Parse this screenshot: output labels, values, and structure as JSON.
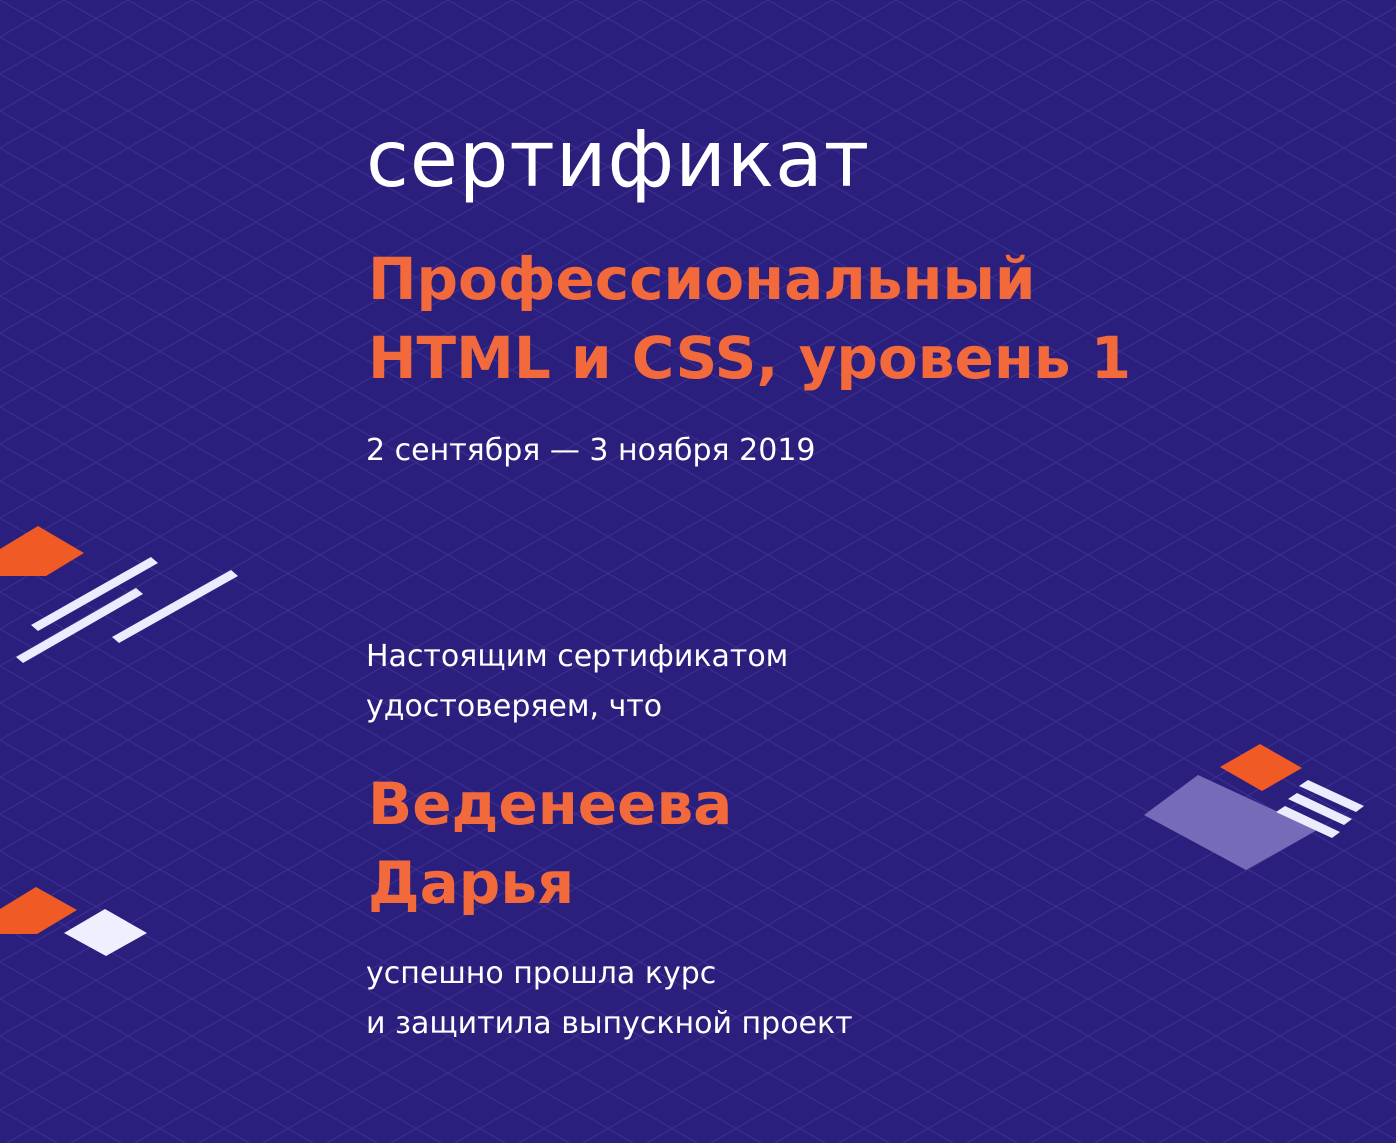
{
  "certificate": {
    "heading": "сертификат",
    "course_lines": [
      "Профессиональный",
      "HTML и CSS, уровень 1"
    ],
    "dates": "2 сентября — 3 ноября 2019",
    "intro_lines": [
      "Настоящим сертификатом",
      "удостоверяем, что"
    ],
    "name_lines": [
      "Веденеева",
      "Дарья"
    ],
    "result_lines": [
      "успешно прошла курс",
      "и защитила выпускной проект"
    ]
  },
  "colors": {
    "background": "#2b1f7d",
    "accent": "#f26a3c",
    "text": "#ffffff",
    "grid": "#4a3ca0",
    "panel": "#8176c2"
  }
}
